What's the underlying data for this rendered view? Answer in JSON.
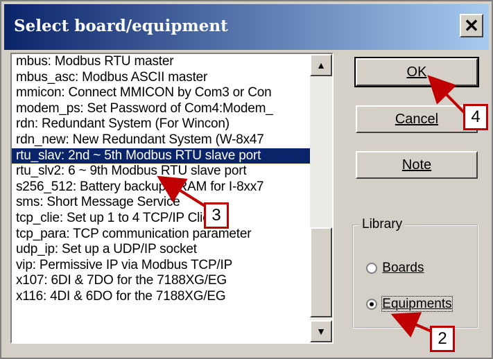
{
  "window": {
    "title": "Select board/equipment",
    "close_glyph": "✕"
  },
  "list": {
    "items": [
      "mbus: Modbus RTU master",
      "mbus_asc: Modbus ASCII master",
      "mmicon: Connect MMICON by Com3 or Con",
      "modem_ps: Set Password of Com4:Modem_",
      "rdn: Redundant System (For Wincon)",
      "rdn_new: New Redundant System (W-8x47",
      "rtu_slav: 2nd ~ 5th Modbus RTU slave port",
      "rtu_slv2: 6 ~ 9th Modbus RTU slave port",
      "s256_512: Battery backup SRAM for I-8xx7",
      "sms: Short Message Service",
      "tcp_clie: Set up 1 to 4 TCP/IP Client",
      "tcp_para: TCP communication parameter",
      "udp_ip: Set up a UDP/IP socket",
      "vip: Permissive IP via Modbus TCP/IP",
      "x107: 6DI & 7DO for the 7188XG/EG",
      "x116: 4DI & 6DO for the 7188XG/EG"
    ],
    "selected_index": 6,
    "scroll_up_glyph": "▲",
    "scroll_down_glyph": "▼"
  },
  "buttons": {
    "ok": "OK",
    "cancel": "Cancel",
    "note": "Note"
  },
  "library": {
    "label": "Library",
    "options": [
      "Boards",
      "Equipments"
    ],
    "selected": "Equipments"
  },
  "callouts": [
    "2",
    "3",
    "4"
  ],
  "colors": {
    "callout_border": "#c00000",
    "arrow": "#c00000",
    "selection": "#0a246a",
    "title_start": "#0a246a",
    "title_end": "#a6caf0"
  }
}
